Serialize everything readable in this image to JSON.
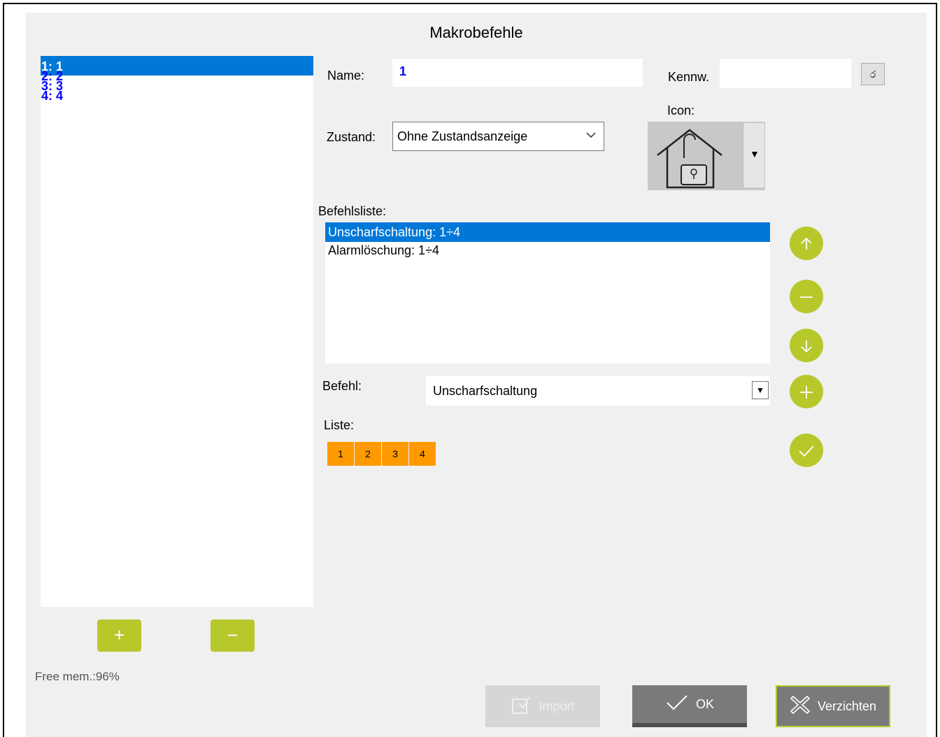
{
  "dialog": {
    "title": "Makrobefehle"
  },
  "macros": [
    {
      "label": "1: 1",
      "selected": true
    },
    {
      "label": "2: 2",
      "selected": false
    },
    {
      "label": "3: 3",
      "selected": false
    },
    {
      "label": "4: 4",
      "selected": false
    }
  ],
  "left_buttons": {
    "add": "+",
    "remove": "−"
  },
  "free_mem": "Free mem.:96%",
  "form": {
    "name_label": "Name:",
    "name_value": "1",
    "password_label": "Kennw.",
    "password_value": "",
    "state_label": "Zustand:",
    "state_value": "Ohne Zustandsanzeige",
    "icon_label": "Icon:",
    "icon_name": "house-unlocked-icon",
    "command_list_label": "Befehlsliste:",
    "commands": [
      {
        "text": "Unscharfschaltung: 1÷4",
        "selected": true
      },
      {
        "text": "Alarmlöschung: 1÷4",
        "selected": false
      }
    ],
    "command_label": "Befehl:",
    "command_value": "Unscharfschaltung",
    "list_label": "Liste:",
    "list_items": [
      "1",
      "2",
      "3",
      "4"
    ]
  },
  "side_buttons": [
    "move-up-icon",
    "remove-icon",
    "move-down-icon",
    "add-icon",
    "confirm-icon"
  ],
  "footer": {
    "import_label": "Import",
    "ok_label": "OK",
    "cancel_label": "Verzichten"
  },
  "colors": {
    "accent_green": "#b7c82b",
    "selection_blue": "#0078d7",
    "chip_orange": "#ff9900",
    "ok_gray": "#7a7a7a"
  }
}
